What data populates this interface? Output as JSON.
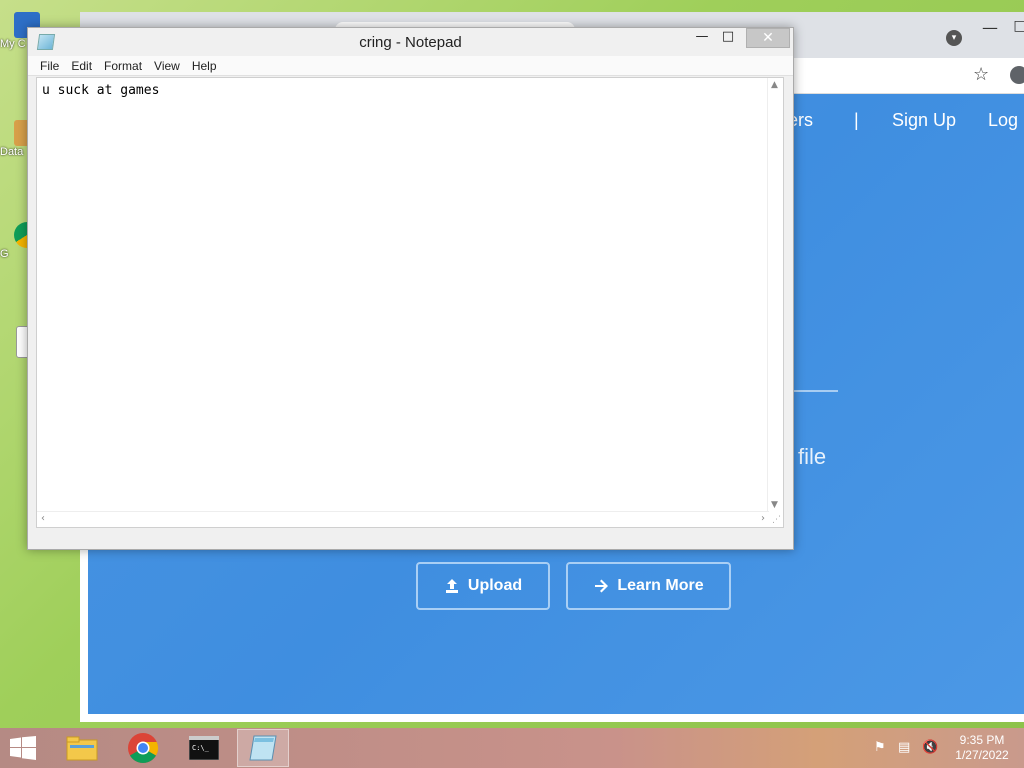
{
  "desktop": {
    "icons": [
      {
        "label": "My C",
        "icon": "computer-icon"
      },
      {
        "label": "Data",
        "icon": "shortcut-icon"
      },
      {
        "label": "G",
        "icon": "chrome-shortcut-icon"
      },
      {
        "label": "",
        "icon": "document-icon"
      }
    ]
  },
  "browser": {
    "nav": {
      "item_partial": "ers",
      "separator": "|",
      "signup": "Sign Up",
      "login_partial": "Log"
    },
    "tagline_partial": "file",
    "buttons": {
      "upload": "Upload",
      "learn_more": "Learn More"
    },
    "colors": {
      "hero_bg": "#4a95e2"
    }
  },
  "notepad": {
    "title": "cring - Notepad",
    "menu": [
      "File",
      "Edit",
      "Format",
      "View",
      "Help"
    ],
    "content": "u suck at games",
    "controls": {
      "minimize": "—",
      "maximize": "□",
      "close": "✕"
    }
  },
  "taskbar": {
    "apps": [
      {
        "name": "file-explorer",
        "active": false
      },
      {
        "name": "chrome",
        "active": false
      },
      {
        "name": "command-prompt",
        "active": false
      },
      {
        "name": "notepad",
        "active": true
      }
    ],
    "clock": {
      "time": "9:35 PM",
      "date": "1/27/2022"
    }
  }
}
